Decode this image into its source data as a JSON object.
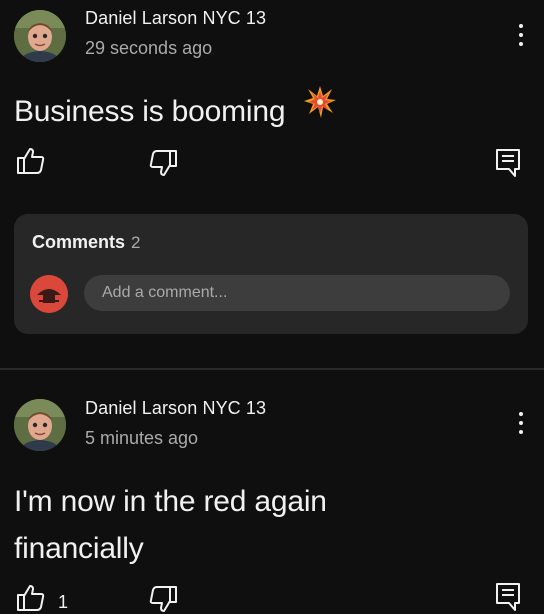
{
  "posts": [
    {
      "author": "Daniel Larson NYC 13",
      "time": "29 seconds ago",
      "text": "Business is booming",
      "emoji_icon": "collision-icon",
      "like_count": "",
      "comments": {
        "title": "Comments",
        "count": "2",
        "placeholder": "Add a comment..."
      }
    },
    {
      "author": "Daniel Larson NYC 13",
      "time": "5 minutes ago",
      "text_lines": [
        "I'm now in the red again",
        "financially"
      ],
      "like_count": "1"
    }
  ],
  "icons": {
    "like": "thumbs-up-icon",
    "dislike": "thumbs-down-icon",
    "comment": "comment-icon",
    "more": "more-vert-icon"
  },
  "colors": {
    "background": "#0f0f0f",
    "card": "#272727",
    "input": "#3d3d3d",
    "text": "#f1f1f1",
    "secondary_text": "#aaaaaa"
  }
}
